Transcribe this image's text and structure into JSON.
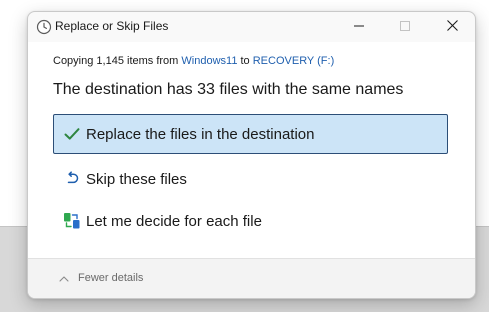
{
  "window": {
    "title": "Replace or Skip Files",
    "controls": {
      "minimize": "minimize-icon",
      "maximize": "maximize-icon",
      "close": "close-icon"
    }
  },
  "copy_status": {
    "prefix": "Copying 1,145 items from ",
    "source": "Windows11",
    "middle": " to ",
    "destination": "RECOVERY (F:)"
  },
  "headline": "The destination has 33 files with the same names",
  "options": [
    {
      "label": "Replace the files in the destination",
      "icon": "checkmark-icon",
      "selected": true
    },
    {
      "label": "Skip these files",
      "icon": "skip-arrow-icon",
      "selected": false
    },
    {
      "label": "Let me decide for each file",
      "icon": "compare-files-icon",
      "selected": false
    }
  ],
  "footer": {
    "toggle_label": "Fewer details",
    "icon": "chevron-up-icon"
  },
  "colors": {
    "accent": "#1f5fae",
    "selected_bg": "#cce4f7",
    "selected_border": "#2c4e77",
    "check_green": "#2e8540"
  }
}
